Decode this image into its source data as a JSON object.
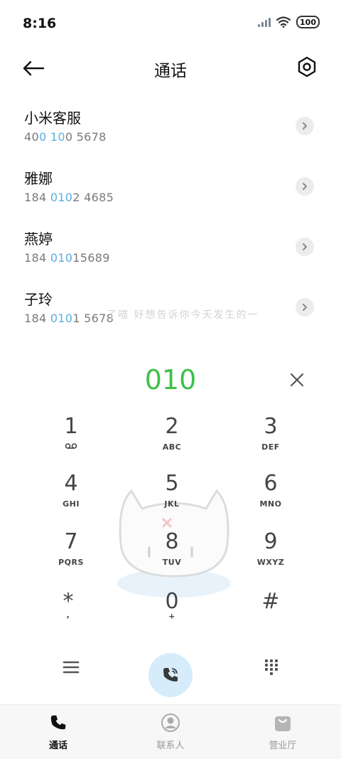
{
  "status": {
    "time": "8:16",
    "battery": "100"
  },
  "header": {
    "title": "通话"
  },
  "contacts": [
    {
      "name": "小米客服",
      "num": {
        "a": "40",
        "b": "0",
        "c": " ",
        "d": "10",
        "e": "0 5678"
      }
    },
    {
      "name": "雅娜",
      "num": {
        "a": "184 ",
        "b": "010",
        "c": "",
        "d": "",
        "e": "2 4685"
      }
    },
    {
      "name": "燕婷",
      "num": {
        "a": "184 ",
        "b": "010",
        "c": "",
        "d": "",
        "e": "15689"
      }
    },
    {
      "name": "子玲",
      "num": {
        "a": "184 ",
        "b": "010",
        "c": "",
        "d": "",
        "e": "1 5678"
      }
    }
  ],
  "deco": {
    "text": "了喵 好想告诉你今天发生的一"
  },
  "dialer": {
    "typed": "010"
  },
  "keys": [
    {
      "num": "1",
      "letters": ""
    },
    {
      "num": "2",
      "letters": "ABC"
    },
    {
      "num": "3",
      "letters": "DEF"
    },
    {
      "num": "4",
      "letters": "GHI"
    },
    {
      "num": "5",
      "letters": "JKL"
    },
    {
      "num": "6",
      "letters": "MNO"
    },
    {
      "num": "7",
      "letters": "PQRS"
    },
    {
      "num": "8",
      "letters": "TUV"
    },
    {
      "num": "9",
      "letters": "WXYZ"
    },
    {
      "num": "*",
      "letters": ","
    },
    {
      "num": "0",
      "letters": "+"
    },
    {
      "num": "#",
      "letters": ""
    }
  ],
  "tabs": [
    {
      "label": "通话",
      "icon": "phone-icon",
      "active": true
    },
    {
      "label": "联系人",
      "icon": "contact-icon",
      "active": false
    },
    {
      "label": "营业厅",
      "icon": "shopping-bag-icon",
      "active": false
    }
  ],
  "colors": {
    "accent": "#3fc04a",
    "highlight": "#5aaee3",
    "call_button": "#d6ecfa"
  }
}
